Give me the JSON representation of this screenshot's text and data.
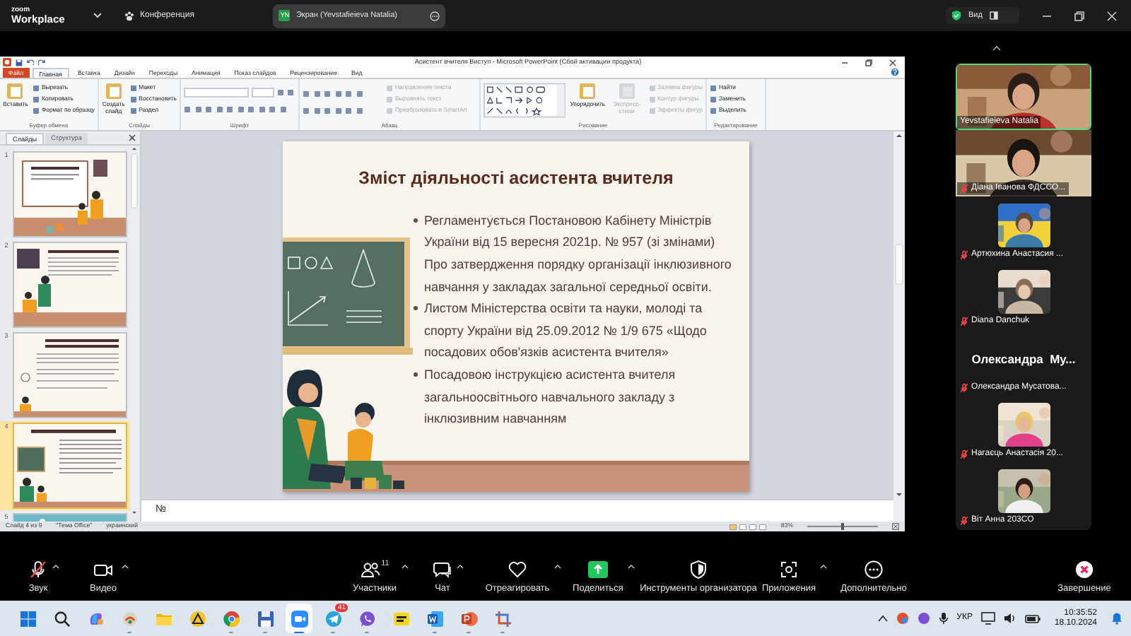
{
  "zoom_bar": {
    "logo_small": "zoom",
    "logo_large": "Workplace",
    "meeting": "Конференция",
    "share": {
      "initials": "YN",
      "label": "Экран (Yevstafieieva Natalia)"
    },
    "view": "Вид"
  },
  "powerpoint": {
    "title": "Асистент вчителя Виступ - Microsoft PowerPoint (Сбой активации продукта)",
    "tabs": [
      {
        "label": "Файл",
        "kind": "file",
        "selected": false
      },
      {
        "label": "Главная",
        "kind": "tab",
        "selected": true
      },
      {
        "label": "Вставка",
        "kind": "tab",
        "selected": false
      },
      {
        "label": "Дизайн",
        "kind": "tab",
        "selected": false
      },
      {
        "label": "Переходы",
        "kind": "tab",
        "selected": false
      },
      {
        "label": "Анимация",
        "kind": "tab",
        "selected": false
      },
      {
        "label": "Показ слайдов",
        "kind": "tab",
        "selected": false
      },
      {
        "label": "Рецензирование",
        "kind": "tab",
        "selected": false
      },
      {
        "label": "Вид",
        "kind": "tab",
        "selected": false
      }
    ],
    "ribbon_groups": [
      {
        "kind": "clipboard",
        "label": "Буфер обмена",
        "items": [
          {
            "kind": "large",
            "label": "Вставить",
            "disabled": false
          },
          {
            "kind": "small",
            "label": "Вырезать",
            "disabled": false
          },
          {
            "kind": "small",
            "label": "Копировать",
            "disabled": false
          },
          {
            "kind": "small",
            "label": "Формат по образцу",
            "disabled": false
          }
        ]
      },
      {
        "kind": "slides",
        "label": "Слайды",
        "items": [
          {
            "kind": "large",
            "label": "Создать слайд",
            "disabled": false
          },
          {
            "kind": "small",
            "label": "Макет",
            "disabled": false
          },
          {
            "kind": "small",
            "label": "Восстановить",
            "disabled": false
          },
          {
            "kind": "small",
            "label": "Раздел",
            "disabled": false
          }
        ]
      },
      {
        "kind": "font",
        "label": "Шрифт"
      },
      {
        "kind": "paragraph",
        "label": "Абзац",
        "items": [
          {
            "kind": "small",
            "label": "Направление текста",
            "disabled": true
          },
          {
            "kind": "small",
            "label": "Выровнять текст",
            "disabled": true
          },
          {
            "kind": "small",
            "label": "Преобразовать в SmartArt",
            "disabled": true
          }
        ]
      },
      {
        "kind": "drawing",
        "label": "Рисование",
        "items": [
          {
            "kind": "large",
            "label": "Упорядочить",
            "disabled": false
          },
          {
            "kind": "large",
            "label": "Экспресс-стили",
            "disabled": true
          },
          {
            "kind": "small",
            "label": "Заливка фигуры",
            "disabled": true
          },
          {
            "kind": "small",
            "label": "Контур фигуры",
            "disabled": true
          },
          {
            "kind": "small",
            "label": "Эффекты фигур",
            "disabled": true
          }
        ]
      },
      {
        "kind": "editing",
        "label": "Редактирование",
        "items": [
          {
            "kind": "small",
            "label": "Найти",
            "disabled": false
          },
          {
            "kind": "small",
            "label": "Заменить",
            "disabled": false
          },
          {
            "kind": "small",
            "label": "Выделить",
            "disabled": false
          }
        ]
      }
    ],
    "pane_tabs": [
      {
        "label": "Слайды",
        "selected": true
      },
      {
        "label": "Структура",
        "selected": false
      }
    ],
    "thumbnails": [
      {
        "number": "1",
        "selected": false
      },
      {
        "number": "2",
        "selected": false
      },
      {
        "number": "3",
        "selected": false
      },
      {
        "number": "4",
        "selected": true
      },
      {
        "number": "5",
        "selected": false
      }
    ],
    "slide": {
      "title": "Зміст діяльності асистента вчителя",
      "bullets": [
        "Регламентується Постановою Кабінету Міністрів України від 15 вересня 2021р. № 957 (зі змінами) Про затвердження порядку організації інклюзивного навчання у закладах загальної середньої освіти.",
        "Листом Міністерства освіти та науки, молоді та спорту України від 25.09.2012 № 1/9 675 «Щодо посадових обов'язків асистента вчителя»",
        "Посадовою інструкцією асистента вчителя загальноосвітнього навчального закладу з інклюзивним навчанням"
      ]
    },
    "notes": "№",
    "status_bar": {
      "items": [
        "Слайд 4 из 9",
        "\"Тема Office\"",
        "украинский"
      ],
      "zoom_percent": "83%",
      "zoom_slider": {
        "level": 0.5
      }
    }
  },
  "participants": [
    {
      "name": "Yevstafieieva Natalia",
      "kind": "full_video",
      "muted": false,
      "speaking": true
    },
    {
      "name": "Діана Іванова ФДССО...",
      "kind": "full_video",
      "muted": true,
      "speaking": false
    },
    {
      "name": "Артюхина Анастасия ...",
      "kind": "thumb_video",
      "muted": true,
      "speaking": false
    },
    {
      "name": "Diana Danchuk",
      "kind": "thumb_video",
      "muted": true,
      "speaking": false
    },
    {
      "name": "Олександра Мусатова...",
      "kind": "name_only",
      "display_name": "Олександра  Му...",
      "muted": true,
      "speaking": false
    },
    {
      "name": "Нагаєць Анастасія 20...",
      "kind": "thumb_video",
      "muted": true,
      "speaking": false
    },
    {
      "name": "Віт Анна 203СО",
      "kind": "thumb_video",
      "muted": true,
      "speaking": false
    }
  ],
  "toolbar": [
    {
      "kind": "mic",
      "label": "Звук",
      "muted": true,
      "caret": true
    },
    {
      "kind": "video",
      "label": "Видео",
      "muted": false,
      "caret": true
    },
    {
      "kind": "participants",
      "label": "Участники",
      "count": "11",
      "caret": true
    },
    {
      "kind": "chat",
      "label": "Чат",
      "caret": true
    },
    {
      "kind": "react",
      "label": "Отреагировать",
      "caret": true
    },
    {
      "kind": "share",
      "label": "Поделиться",
      "caret": true
    },
    {
      "kind": "host",
      "label": "Инструменты организатора",
      "caret": false
    },
    {
      "kind": "apps",
      "label": "Приложения",
      "caret": true
    },
    {
      "kind": "more",
      "label": "Дополнительно",
      "caret": false
    },
    {
      "kind": "end",
      "label": "Завершение",
      "caret": false
    }
  ],
  "taskbar": {
    "apps": [
      {
        "kind": "start",
        "running": false,
        "active": false
      },
      {
        "kind": "search",
        "running": false,
        "active": false
      },
      {
        "kind": "copilot",
        "running": false,
        "active": false
      },
      {
        "kind": "round_app",
        "running": true,
        "active": false
      },
      {
        "kind": "folder",
        "running": false,
        "active": false
      },
      {
        "kind": "triangle",
        "running": false,
        "active": false
      },
      {
        "kind": "chrome",
        "running": true,
        "active": false
      },
      {
        "kind": "floppy",
        "running": true,
        "active": false
      },
      {
        "kind": "zoom",
        "running": true,
        "active": true
      },
      {
        "kind": "telegram",
        "running": true,
        "active": false,
        "badge": "41"
      },
      {
        "kind": "viber",
        "running": true,
        "active": false
      },
      {
        "kind": "fw",
        "running": false,
        "active": false
      },
      {
        "kind": "word",
        "running": true,
        "active": false
      },
      {
        "kind": "powerpoint",
        "running": true,
        "active": false
      },
      {
        "kind": "snip",
        "running": true,
        "active": false
      }
    ],
    "tray": {
      "language": "УКР",
      "time": "10:35:52",
      "date": "18.10.2024"
    }
  }
}
